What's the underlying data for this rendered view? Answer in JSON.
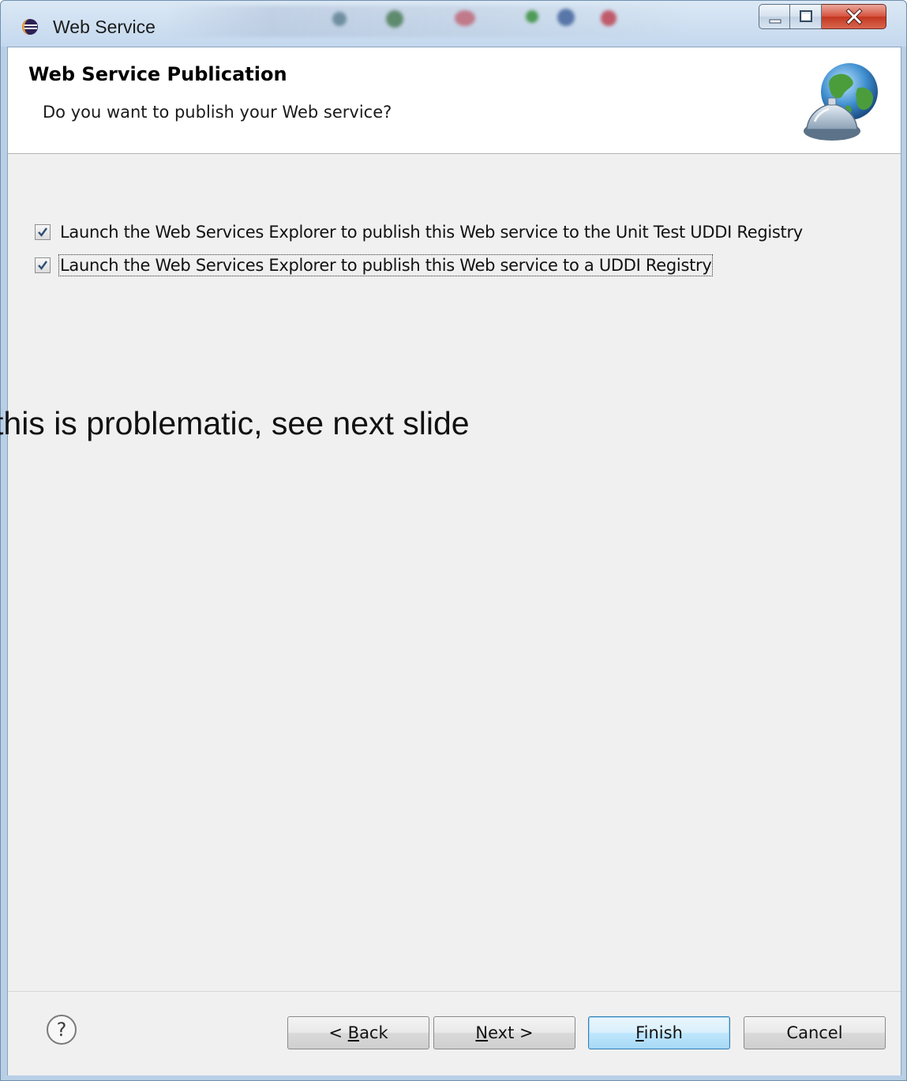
{
  "window": {
    "title": "Web Service",
    "app_icon": "eclipse-icon",
    "controls": [
      "minimize-icon",
      "maximize-icon",
      "close-icon"
    ]
  },
  "banner": {
    "title": "Web Service Publication",
    "description": "Do you want to publish your Web service?",
    "icon": "globe-publish-icon"
  },
  "options": [
    {
      "label": "Launch the Web Services Explorer to publish this Web service to the Unit Test UDDI Registry",
      "checked": true
    },
    {
      "label": "Launch the Web Services Explorer to publish this Web service to a UDDI Registry",
      "checked": true
    }
  ],
  "overlay_note": "this is problematic, see next slide",
  "footer": {
    "help_icon": "help-icon",
    "back": {
      "prefix": "< ",
      "mnemonic": "B",
      "rest": "ack"
    },
    "next": {
      "mnemonic": "N",
      "rest": "ext >"
    },
    "finish": {
      "mnemonic": "F",
      "rest": "inish"
    },
    "cancel": "Cancel"
  },
  "colors": {
    "titlebar": "#c4d8ee",
    "close_button": "#c3361f",
    "default_button_border": "#3c7fb1",
    "body_background": "#f0f0f0"
  }
}
